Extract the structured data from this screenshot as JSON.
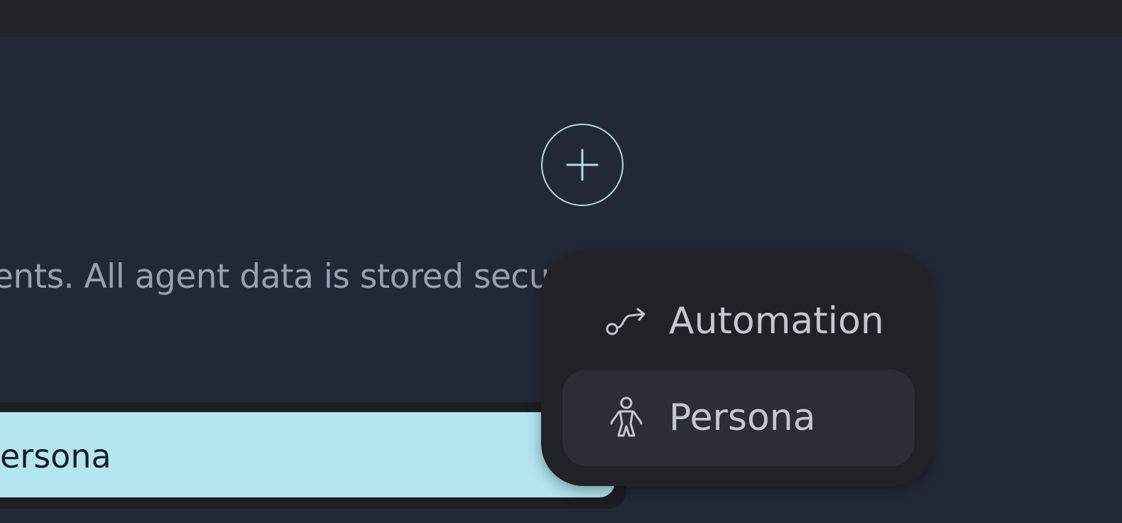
{
  "description_text": "ents. All agent data is stored secu",
  "cta": {
    "label": "ersona"
  },
  "add_button": {
    "icon": "plus-icon"
  },
  "dropdown": {
    "items": [
      {
        "label": "Automation",
        "icon": "automation-path-icon"
      },
      {
        "label": "Persona",
        "icon": "person-icon"
      }
    ]
  },
  "colors": {
    "background": "#232838",
    "topbar": "#212429",
    "accent": "#b3e6f1",
    "circle_stroke": "#a9dde8",
    "menu_bg": "#202227",
    "menu_hover": "#2b2e36",
    "menu_text": "#c3c7cf",
    "muted_text": "#9aa0ab"
  }
}
